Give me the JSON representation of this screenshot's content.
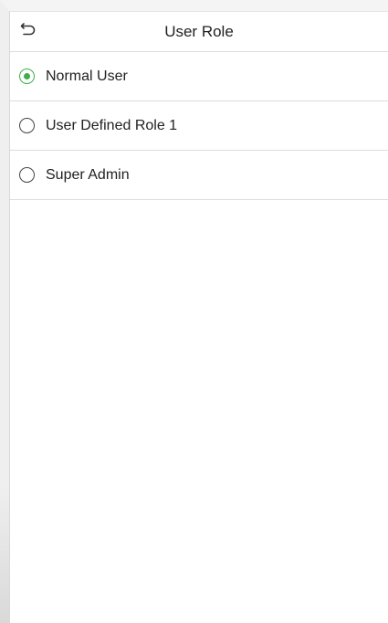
{
  "header": {
    "title": "User Role",
    "back_icon": "back-arrow-icon"
  },
  "options": [
    {
      "label": "Normal User",
      "selected": true
    },
    {
      "label": "User Defined Role 1",
      "selected": false
    },
    {
      "label": "Super Admin",
      "selected": false
    }
  ],
  "colors": {
    "accent": "#3fae49",
    "divider": "#dcdcdc",
    "text": "#222222"
  }
}
